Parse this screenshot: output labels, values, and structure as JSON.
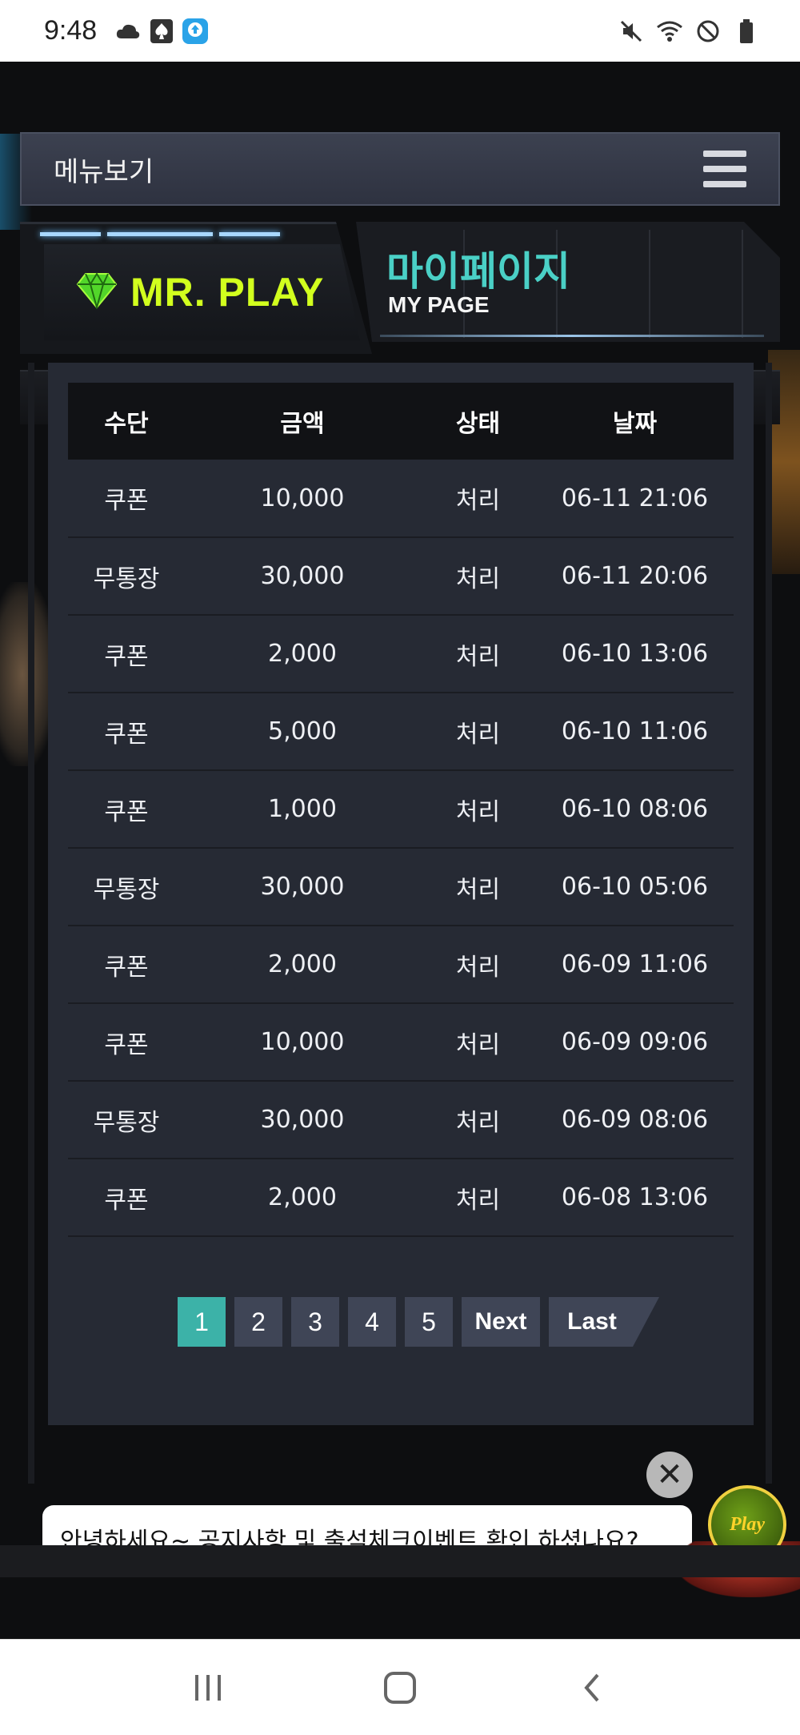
{
  "status_bar": {
    "time": "9:48",
    "left_icons": [
      "cloud-icon",
      "spade-card-icon",
      "app-update-icon"
    ],
    "right_icons": [
      "mute-icon",
      "wifi-icon",
      "do-not-disturb-icon",
      "battery-icon"
    ]
  },
  "menu": {
    "label": "메뉴보기"
  },
  "banner": {
    "brand": "MR. PLAY",
    "title_ko": "마이페이지",
    "title_en": "MY PAGE"
  },
  "table": {
    "headers": [
      "수단",
      "금액",
      "상태",
      "날짜"
    ],
    "rows": [
      [
        "쿠폰",
        "10,000",
        "처리",
        "06-11 21:06"
      ],
      [
        "무통장",
        "30,000",
        "처리",
        "06-11 20:06"
      ],
      [
        "쿠폰",
        "2,000",
        "처리",
        "06-10 13:06"
      ],
      [
        "쿠폰",
        "5,000",
        "처리",
        "06-10 11:06"
      ],
      [
        "쿠폰",
        "1,000",
        "처리",
        "06-10 08:06"
      ],
      [
        "무통장",
        "30,000",
        "처리",
        "06-10 05:06"
      ],
      [
        "쿠폰",
        "2,000",
        "처리",
        "06-09 11:06"
      ],
      [
        "쿠폰",
        "10,000",
        "처리",
        "06-09 09:06"
      ],
      [
        "무통장",
        "30,000",
        "처리",
        "06-09 08:06"
      ],
      [
        "쿠폰",
        "2,000",
        "처리",
        "06-08 13:06"
      ]
    ]
  },
  "pagination": {
    "pages": [
      "1",
      "2",
      "3",
      "4",
      "5"
    ],
    "current": "1",
    "next_label": "Next",
    "last_label": "Last"
  },
  "chat": {
    "close_symbol": "✕",
    "message": "안녕하세요~ 공지사항 및 출석체크이벤트 확인 하셨나요?",
    "mascot_text": "Play"
  },
  "colors": {
    "brand_green": "#d2ff1e",
    "title_teal": "#4ad0c6",
    "active_page": "#3cb2a8",
    "panel_bg": "#262a34"
  }
}
